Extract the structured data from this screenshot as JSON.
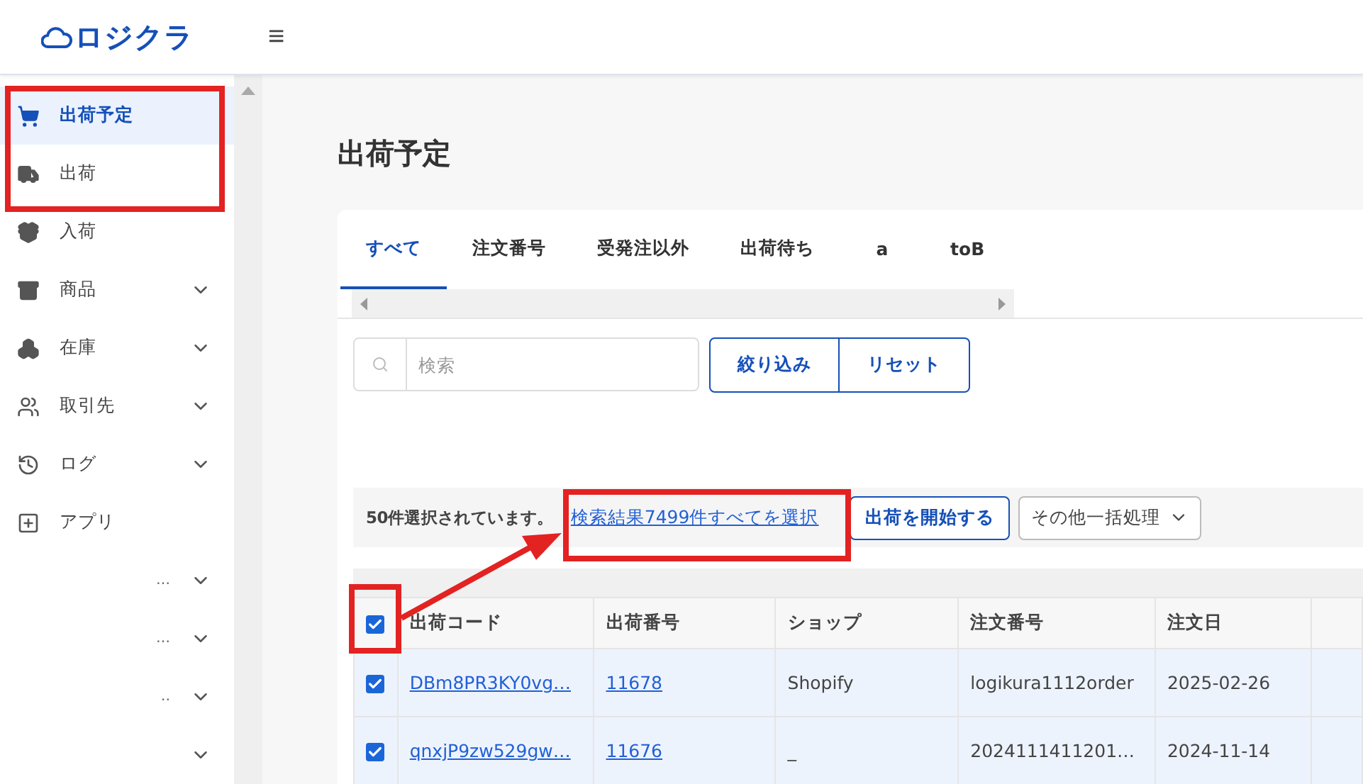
{
  "header": {
    "logo": "ロジクラ",
    "menu_icon": "≡"
  },
  "sidebar": {
    "items": [
      {
        "label": "出荷予定",
        "selected": true,
        "expandable": false
      },
      {
        "label": "出荷",
        "selected": false,
        "expandable": false
      },
      {
        "label": "入荷",
        "selected": false,
        "expandable": false
      },
      {
        "label": "商品",
        "selected": false,
        "expandable": true
      },
      {
        "label": "在庫",
        "selected": false,
        "expandable": true
      },
      {
        "label": "取引先",
        "selected": false,
        "expandable": true
      },
      {
        "label": "ログ",
        "selected": false,
        "expandable": true
      },
      {
        "label": "アプリ",
        "selected": false,
        "expandable": false
      },
      {
        "label": "…",
        "selected": false,
        "expandable": true
      },
      {
        "label": "…",
        "selected": false,
        "expandable": true
      },
      {
        "label": "‥",
        "selected": false,
        "expandable": true
      },
      {
        "selected": false,
        "expandable": true
      }
    ]
  },
  "page": {
    "title": "出荷予定"
  },
  "tabs": [
    {
      "label": "すべて",
      "selected": true
    },
    {
      "label": "注文番号",
      "selected": false
    },
    {
      "label": "受発注以外",
      "selected": false
    },
    {
      "label": "出荷待ち",
      "selected": false
    },
    {
      "label": "a",
      "selected": false
    },
    {
      "label": "toB",
      "selected": false
    }
  ],
  "search": {
    "placeholder": "検索"
  },
  "filter_buttons": [
    "絞り込み",
    "リセット"
  ],
  "selection_bar": {
    "message": "50件選択されています。",
    "select_all_link": "検索結果7499件すべてを選択",
    "start_button": "出荷を開始する",
    "bulk_menu": "その他一括処理"
  },
  "table": {
    "all_checked": true,
    "columns": [
      "出荷コード",
      "出荷番号",
      "ショップ",
      "注文番号",
      "注文日"
    ],
    "rows": [
      {
        "checked": true,
        "cells": [
          "DBm8PR3KY0vg…",
          "11678",
          "Shopify",
          "logikura1112order",
          "2025-02-26"
        ]
      },
      {
        "checked": true,
        "cells": [
          "qnxjP9zw529gw…",
          "11676",
          "_",
          "2024111411201…",
          "2024-11-14"
        ]
      }
    ]
  }
}
